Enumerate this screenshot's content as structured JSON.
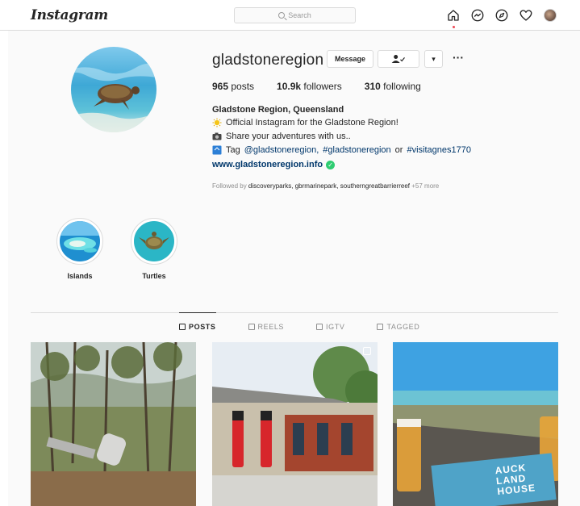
{
  "topbar": {
    "logo": "Instagram",
    "search_placeholder": "Search",
    "icons": [
      "home-icon",
      "messenger-icon",
      "explore-icon",
      "activity-heart-icon",
      "profile-avatar"
    ]
  },
  "profile": {
    "username": "gladstoneregion",
    "buttons": {
      "message": "Message",
      "follow_icon": "person-check-icon",
      "dropdown": "▾",
      "more": "···"
    },
    "stats": [
      {
        "value": "965",
        "label": " posts"
      },
      {
        "value": "10.9k",
        "label": " followers"
      },
      {
        "value": "310",
        "label": " following"
      }
    ],
    "bio": {
      "name": "Gladstone Region, Queensland",
      "line1": "Official Instagram for the Gladstone Region!",
      "line2": "Share your adventures with us..",
      "line3_prefix": "Tag",
      "line3_tag1": "@gladstoneregion,",
      "line3_tag2": "#gladstoneregion",
      "line3_or": "or",
      "line3_tag3": "#visitagnes1770",
      "website": "www.gladstoneregion.info"
    },
    "followed_by": {
      "prefix": "Followed by ",
      "names": "discoveryparks, gbrmarinepark, southerngreatbarrierreef",
      "suffix": " +57 more"
    }
  },
  "highlights": [
    {
      "label": "Islands"
    },
    {
      "label": "Turtles"
    }
  ],
  "tabs": [
    {
      "label": "POSTS",
      "active": true
    },
    {
      "label": "REELS",
      "active": false
    },
    {
      "label": "IGTV",
      "active": false
    },
    {
      "label": "TAGGED",
      "active": false
    }
  ],
  "posts": [
    {
      "caption": ""
    },
    {
      "caption": ""
    },
    {
      "sign_text": "AUCK LAND HOUSE"
    }
  ],
  "colors": {
    "link": "#00376b",
    "border": "#dbdbdb",
    "bg": "#fafafa",
    "notification": "#ed4956"
  }
}
